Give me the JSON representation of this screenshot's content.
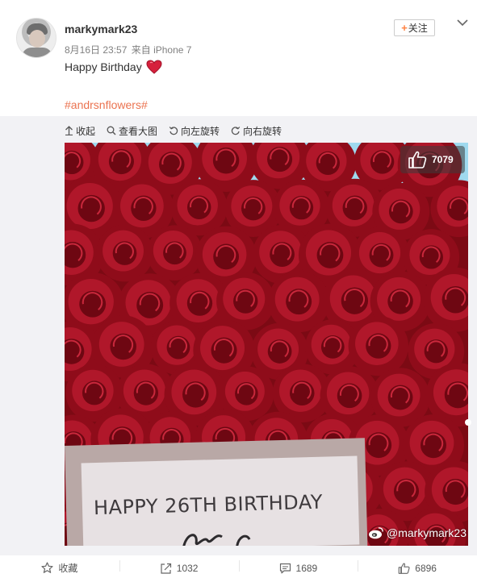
{
  "user": {
    "name": "markymark23",
    "date": "8月16日 23:57",
    "via": "来自 iPhone 7",
    "follow_label": "关注",
    "follow_plus": "+"
  },
  "post": {
    "text": "Happy Birthday",
    "emoji": "heart-icon",
    "hashtag": "#andrsnflowers#"
  },
  "toolbar": {
    "collapse": "收起",
    "view_large": "查看大图",
    "rotate_left": "向左旋转",
    "rotate_right": "向右旋转"
  },
  "image": {
    "like_count": "7079",
    "card_text": "HAPPY 26TH BIRTHDAY",
    "watermark": "@markymark23"
  },
  "actions": {
    "favorite": "收藏",
    "repost": "1032",
    "comment": "1689",
    "like": "6896"
  },
  "colors": {
    "accent": "#eb7350",
    "plus": "#ff8140",
    "rose": "#9a0f1d",
    "sky": "#9fd9ee"
  }
}
